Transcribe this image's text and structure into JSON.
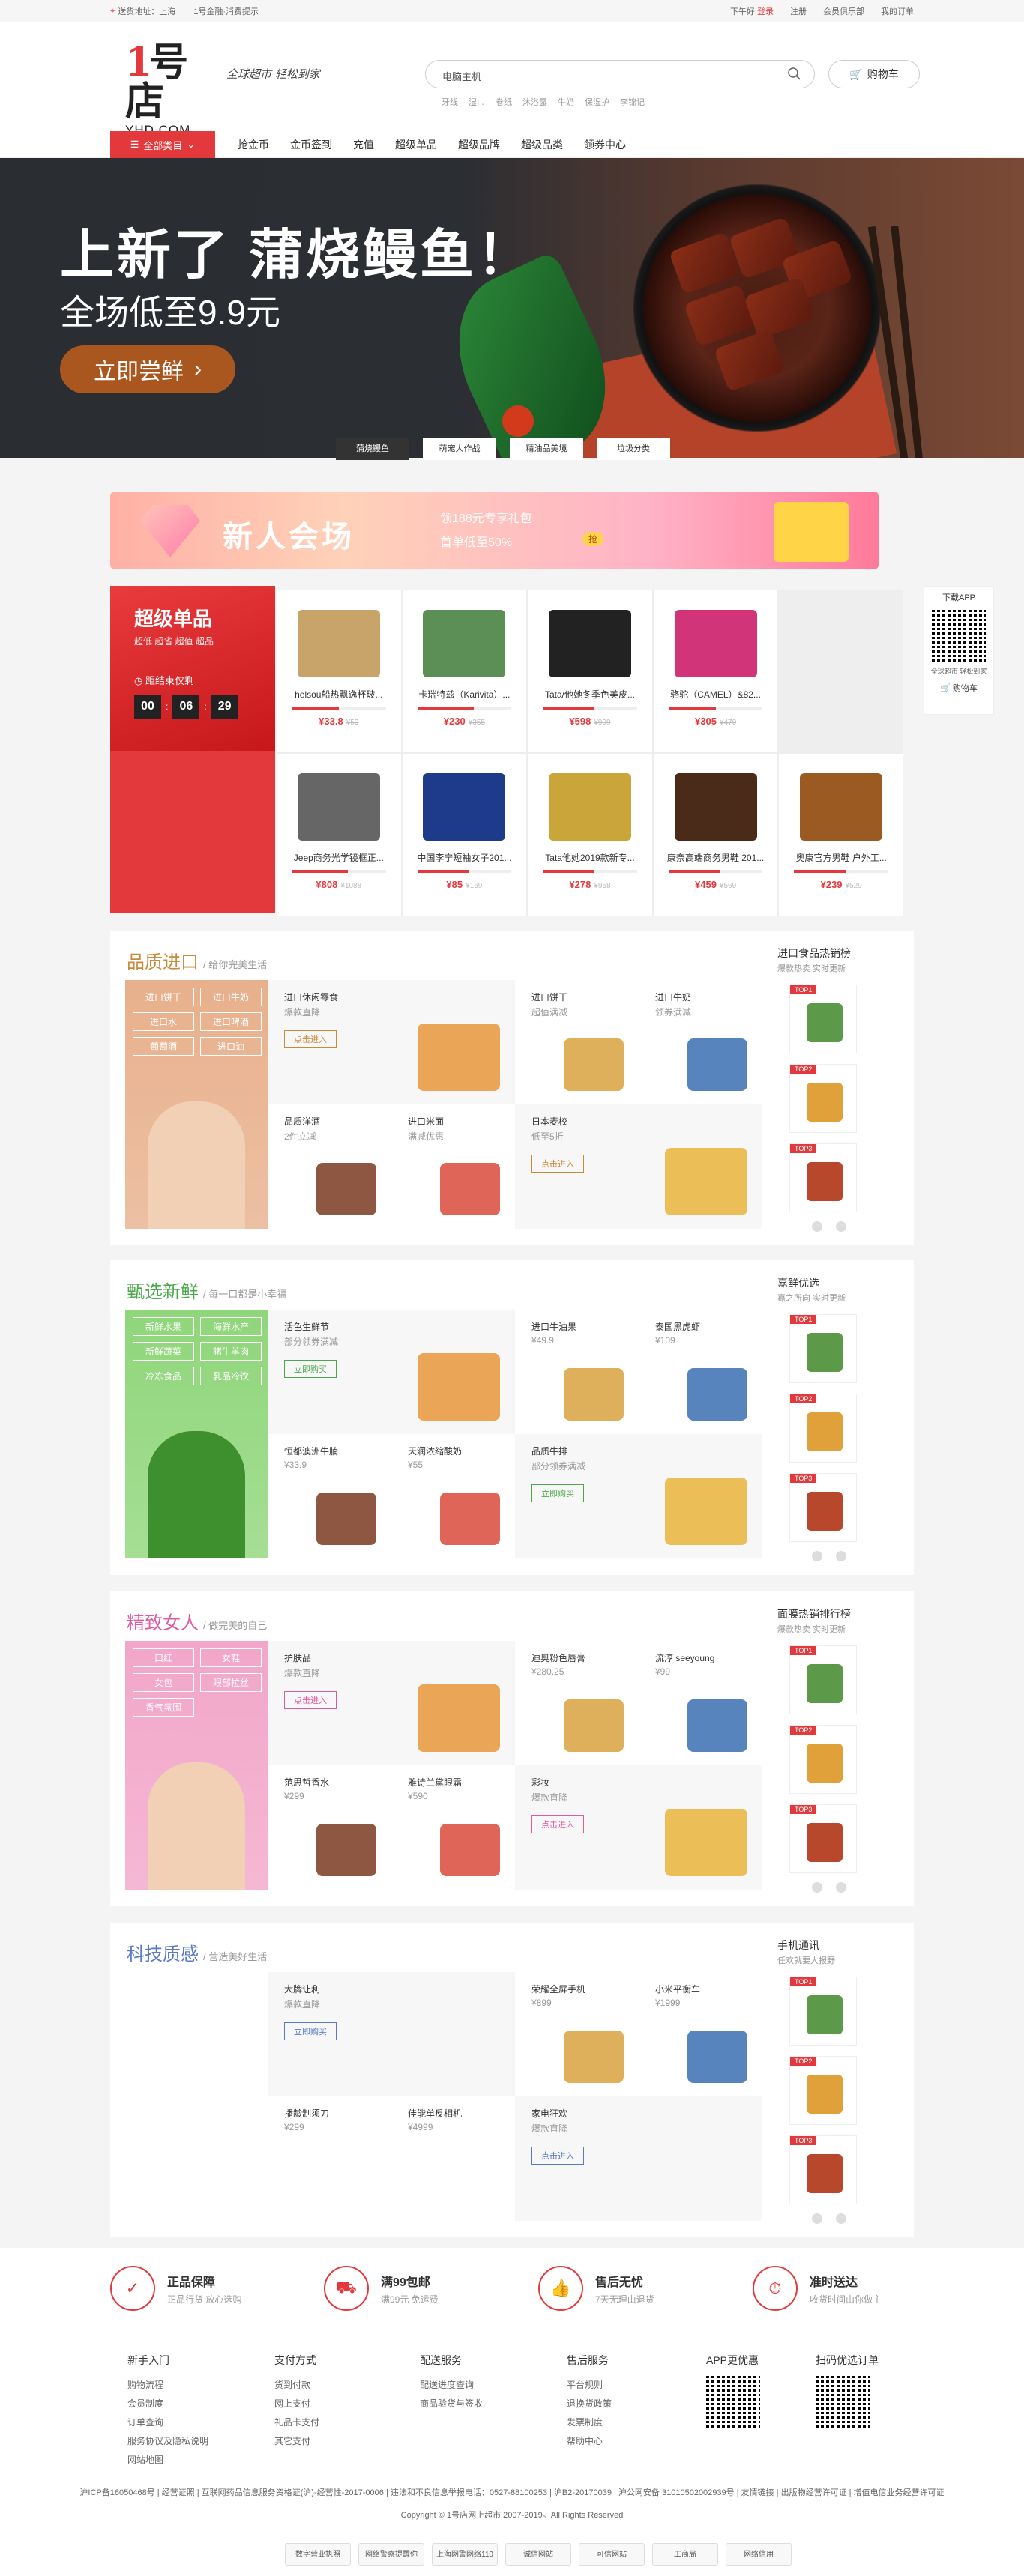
{
  "topbar": {
    "location": "送货地址：上海",
    "finance": "1号金融·消费提示",
    "greeting": "下午好",
    "login": "登录",
    "register": "注册",
    "member": "会员俱乐部",
    "orders": "我的订单"
  },
  "header": {
    "logo_num": "1号店",
    "logo_text": "YHD.COM",
    "slogan": "全球超市 轻松到家",
    "search_placeholder": "电脑主机",
    "cart": "购物车",
    "hotwords": [
      "牙线",
      "湿巾",
      "卷纸",
      "沐浴露",
      "牛奶",
      "保湿护",
      "李锦记"
    ]
  },
  "nav": {
    "all": "全部类目",
    "items": [
      "抢金币",
      "金币签到",
      "充值",
      "超级单品",
      "超级品牌",
      "超级品类",
      "领券中心"
    ]
  },
  "banner": {
    "title": "上新了 蒲烧鳗鱼！",
    "subtitle": "全场低至9.9元",
    "cta": "立即尝鲜",
    "tabs": [
      "蒲烧鳗鱼",
      "萌宠大作战",
      "精油品美境",
      "垃圾分类"
    ]
  },
  "newbanner": {
    "title": "新人会场",
    "line1": "领188元专享礼包",
    "line2": "首单低至50%",
    "tag": "抢"
  },
  "super": {
    "title": "超级单品",
    "sub": "超低 超省 超值 超品",
    "countdown_label": "距结束仅剩",
    "h": "00",
    "m": "06",
    "s": "29",
    "items": [
      {
        "name": "helsou船热飘逸杯玻...",
        "price": "¥33.8",
        "old": "¥53",
        "color": "#c9a46a",
        "progress": 0.5
      },
      {
        "name": "卡瑞特兹（Karivita）...",
        "price": "¥230",
        "old": "¥355",
        "color": "#5b8f56",
        "progress": 0.6
      },
      {
        "name": "Tata/他她冬季色美皮...",
        "price": "¥598",
        "old": "¥999",
        "color": "#222",
        "progress": 0.55
      },
      {
        "name": "骆驼（CAMEL）&82...",
        "price": "¥305",
        "old": "¥470",
        "color": "#d2347a",
        "progress": 0.5
      },
      {
        "name": "Jeep商务光学镜框正...",
        "price": "¥808",
        "old": "¥1088",
        "color": "#666",
        "progress": 0.6
      },
      {
        "name": "中国李宁短袖女子201...",
        "price": "¥85",
        "old": "¥169",
        "color": "#1e3a8a",
        "progress": 0.55
      },
      {
        "name": "Tata他她2019款新专...",
        "price": "¥278",
        "old": "¥958",
        "color": "#caa53a",
        "progress": 0.55
      },
      {
        "name": "康奈高端商务男鞋 201...",
        "price": "¥459",
        "old": "¥569",
        "color": "#4a2a18",
        "progress": 0.55
      },
      {
        "name": "奥康官方男鞋 户外工...",
        "price": "¥239",
        "old": "¥529",
        "color": "#9a5a22",
        "progress": 0.55
      }
    ]
  },
  "side": {
    "title": "下载APP",
    "text": "全球超市 轻松到家",
    "cart": "购物车"
  },
  "floors": [
    {
      "title": "品质进口",
      "sub": "/ 给你完美生活",
      "color": "#c98a3a",
      "lcolor": "#e8b08c",
      "tags": [
        "进口饼干",
        "进口牛奶",
        "进口水",
        "进口啤酒",
        "葡萄酒",
        "进口油"
      ],
      "cells": [
        {
          "t": "进口休闲零食",
          "st": "爆款直降",
          "btn": "点击进入"
        },
        {
          "t": "进口饼干",
          "st": "超值满减"
        },
        {
          "t": "进口牛奶",
          "st": "领券满减"
        },
        {
          "t": "品质洋酒",
          "st": "2件立减"
        },
        {
          "t": "进口米面",
          "st": "满减优惠"
        },
        {
          "t": "日本麦校",
          "st": "低至5折",
          "btn": "点击进入"
        }
      ],
      "rank": {
        "t": "进口食品热销榜",
        "s": "爆款热卖 实时更新"
      }
    },
    {
      "title": "甄选新鲜",
      "sub": "/ 每一口都是小幸福",
      "color": "#4aa84a",
      "lcolor": "#8fd67a",
      "tags": [
        "新鲜水果",
        "海鲜水产",
        "新鲜蔬菜",
        "猪牛羊肉",
        "冷冻食品",
        "乳品冷饮"
      ],
      "cells": [
        {
          "t": "活色生鲜节",
          "st": "部分领券满减",
          "btn": "立即购买"
        },
        {
          "t": "进口牛油果",
          "st": "¥49.9"
        },
        {
          "t": "泰国黑虎虾",
          "st": "¥109"
        },
        {
          "t": "恒都澳洲牛腩",
          "st": "¥33.9"
        },
        {
          "t": "天润浓缩酸奶",
          "st": "¥55"
        },
        {
          "t": "品质牛排",
          "st": "部分领券满减",
          "btn": "立即购买"
        }
      ],
      "rank": {
        "t": "嘉鲜优选",
        "s": "嘉之所向 实时更新"
      }
    },
    {
      "title": "精致女人",
      "sub": "/ 做完美的自己",
      "color": "#e05aa0",
      "lcolor": "#f2a6c9",
      "tags": [
        "口红",
        "女鞋",
        "女包",
        "眼部拉丝",
        "香气氛围"
      ],
      "cells": [
        {
          "t": "护肤品",
          "st": "爆款直降",
          "btn": "点击进入"
        },
        {
          "t": "迪奥粉色唇膏",
          "st": "¥280.25"
        },
        {
          "t": "流淳 seeyoung",
          "st": "¥99"
        },
        {
          "t": "范思哲香水",
          "st": "¥299"
        },
        {
          "t": "雅诗兰黛眼霜",
          "st": "¥590"
        },
        {
          "t": "彩妆",
          "st": "爆款直降",
          "btn": "点击进入"
        }
      ],
      "rank": {
        "t": "面膜热销排行榜",
        "s": "爆款热卖 实时更新"
      }
    },
    {
      "title": "科技质感",
      "sub": "/ 营造美好生活",
      "color": "#5a7ac6",
      "lcolor": "#ffffff",
      "tags": [],
      "cells": [
        {
          "t": "大牌让利",
          "st": "爆款直降",
          "btn": "立即购买"
        },
        {
          "t": "荣耀全屏手机",
          "st": "¥899"
        },
        {
          "t": "小米平衡车",
          "st": "¥1999"
        },
        {
          "t": "播龄制须刀",
          "st": "¥299"
        },
        {
          "t": "佳能单反相机",
          "st": "¥4999"
        },
        {
          "t": "家电狂欢",
          "st": "爆款直降",
          "btn": "点击进入"
        }
      ],
      "rank": {
        "t": "手机通讯",
        "s": "任欢就要大报野"
      }
    }
  ],
  "services": [
    {
      "a": "正品保障",
      "b": "正品行货 放心选购",
      "icon": "✓"
    },
    {
      "a": "满99包邮",
      "b": "满99元 免运费",
      "icon": "⛟"
    },
    {
      "a": "售后无忧",
      "b": "7天无理由退货",
      "icon": "👍"
    },
    {
      "a": "准时送达",
      "b": "收货时间由你做主",
      "icon": "⏱"
    }
  ],
  "footlinks": [
    {
      "h": "新手入门",
      "items": [
        "购物流程",
        "会员制度",
        "订单查询",
        "服务协议及隐私说明",
        "网站地图"
      ]
    },
    {
      "h": "支付方式",
      "items": [
        "货到付款",
        "网上支付",
        "礼品卡支付",
        "其它支付"
      ]
    },
    {
      "h": "配送服务",
      "items": [
        "配送进度查询",
        "商品验货与签收"
      ]
    },
    {
      "h": "售后服务",
      "items": [
        "平台规则",
        "退换货政策",
        "发票制度",
        "帮助中心"
      ]
    },
    {
      "h": "APP更优惠",
      "items": []
    },
    {
      "h": "扫码优选订单",
      "items": []
    }
  ],
  "foot": {
    "line1": "沪ICP备16050468号 | 经营证照 | 互联网药品信息服务资格证(沪)-经营性-2017-0006 | 违法和不良信息举报电话：0527-88100253 | 沪B2-20170039 | 沪公网安备 31010502002939号 | 友情链接 | 出版物经营许可证 | 增值电信业务经营许可证",
    "line2": "Copyright © 1号店网上超市 2007-2019。All Rights Reserved",
    "badges": [
      "数字营业执照",
      "网络警察提醒你",
      "上海网警网络110",
      "诚信网站",
      "可信网站",
      "工商局",
      "网络信用"
    ]
  }
}
